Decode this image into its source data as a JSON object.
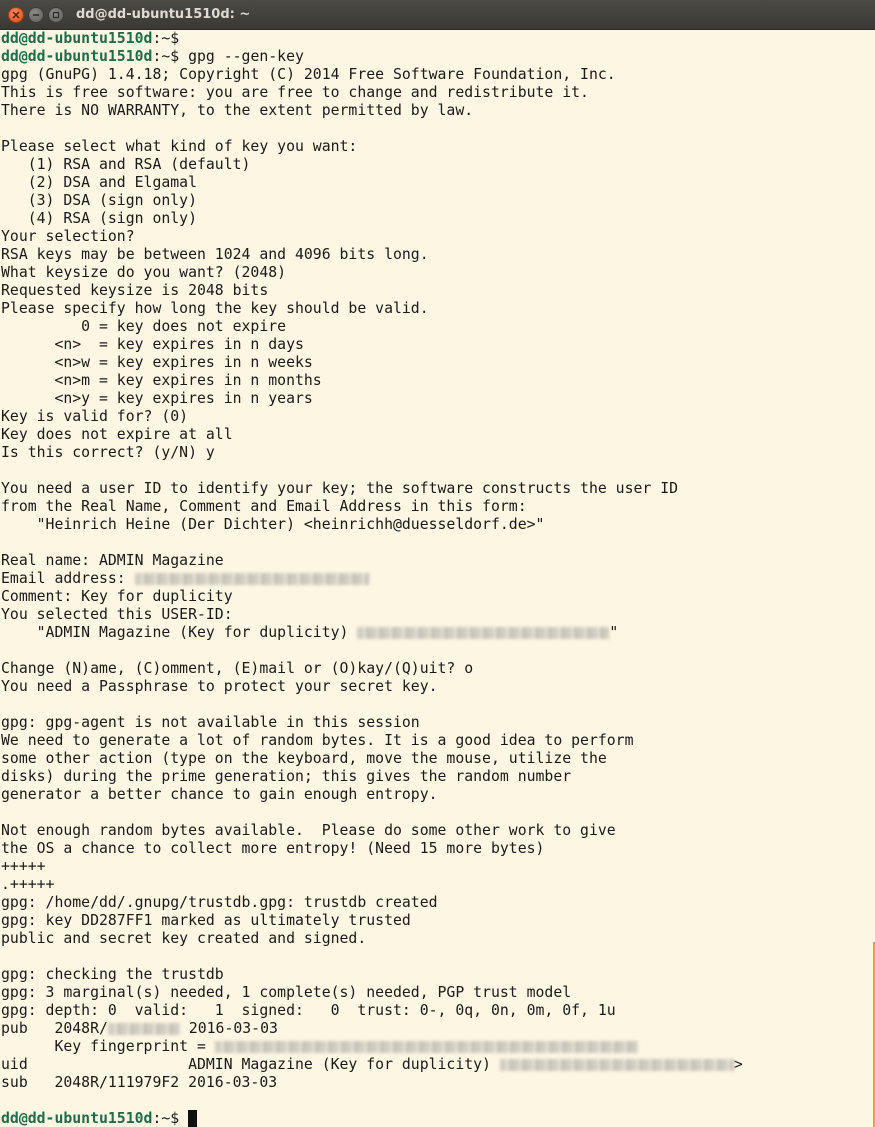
{
  "window": {
    "title": "dd@dd-ubuntu1510d: ~"
  },
  "terminal": {
    "prompt": "dd@dd-ubuntu1510d",
    "lines": [
      {
        "prompt": "dd@dd-ubuntu1510d",
        "sep": ":~$",
        "cmd": ""
      },
      {
        "prompt": "dd@dd-ubuntu1510d",
        "sep": ":~$",
        "cmd": " gpg --gen-key"
      },
      {
        "text": "gpg (GnuPG) 1.4.18; Copyright (C) 2014 Free Software Foundation, Inc."
      },
      {
        "text": "This is free software: you are free to change and redistribute it."
      },
      {
        "text": "There is NO WARRANTY, to the extent permitted by law."
      },
      {
        "text": ""
      },
      {
        "text": "Please select what kind of key you want:"
      },
      {
        "text": "   (1) RSA and RSA (default)"
      },
      {
        "text": "   (2) DSA and Elgamal"
      },
      {
        "text": "   (3) DSA (sign only)"
      },
      {
        "text": "   (4) RSA (sign only)"
      },
      {
        "text": "Your selection?"
      },
      {
        "text": "RSA keys may be between 1024 and 4096 bits long."
      },
      {
        "text": "What keysize do you want? (2048)"
      },
      {
        "text": "Requested keysize is 2048 bits"
      },
      {
        "text": "Please specify how long the key should be valid."
      },
      {
        "text": "         0 = key does not expire"
      },
      {
        "text": "      <n>  = key expires in n days"
      },
      {
        "text": "      <n>w = key expires in n weeks"
      },
      {
        "text": "      <n>m = key expires in n months"
      },
      {
        "text": "      <n>y = key expires in n years"
      },
      {
        "text": "Key is valid for? (0)"
      },
      {
        "text": "Key does not expire at all"
      },
      {
        "text": "Is this correct? (y/N) y"
      },
      {
        "text": ""
      },
      {
        "text": "You need a user ID to identify your key; the software constructs the user ID"
      },
      {
        "text": "from the Real Name, Comment and Email Address in this form:"
      },
      {
        "text": "    \"Heinrich Heine (Der Dichter) <heinrichh@duesseldorf.de>\""
      },
      {
        "text": ""
      },
      {
        "text": "Real name: ADMIN Magazine"
      },
      {
        "text": "Email address: ",
        "redacted": true,
        "redact_chars": 26
      },
      {
        "text": "Comment: Key for duplicity"
      },
      {
        "text": "You selected this USER-ID:"
      },
      {
        "text": "    \"ADMIN Magazine (Key for duplicity) ",
        "redacted": true,
        "redact_chars": 28,
        "after": "\""
      },
      {
        "text": ""
      },
      {
        "text": "Change (N)ame, (C)omment, (E)mail or (O)kay/(Q)uit? o"
      },
      {
        "text": "You need a Passphrase to protect your secret key."
      },
      {
        "text": ""
      },
      {
        "text": "gpg: gpg-agent is not available in this session"
      },
      {
        "text": "We need to generate a lot of random bytes. It is a good idea to perform"
      },
      {
        "text": "some other action (type on the keyboard, move the mouse, utilize the"
      },
      {
        "text": "disks) during the prime generation; this gives the random number"
      },
      {
        "text": "generator a better chance to gain enough entropy."
      },
      {
        "text": ""
      },
      {
        "text": "Not enough random bytes available.  Please do some other work to give"
      },
      {
        "text": "the OS a chance to collect more entropy! (Need 15 more bytes)"
      },
      {
        "text": "+++++"
      },
      {
        "text": ".+++++"
      },
      {
        "text": "gpg: /home/dd/.gnupg/trustdb.gpg: trustdb created"
      },
      {
        "text": "gpg: key DD287FF1 marked as ultimately trusted"
      },
      {
        "text": "public and secret key created and signed."
      },
      {
        "text": ""
      },
      {
        "text": "gpg: checking the trustdb"
      },
      {
        "text": "gpg: 3 marginal(s) needed, 1 complete(s) needed, PGP trust model"
      },
      {
        "text": "gpg: depth: 0  valid:   1  signed:   0  trust: 0-, 0q, 0n, 0m, 0f, 1u"
      },
      {
        "text": "pub   2048R/",
        "redacted": true,
        "redact_chars": 8,
        "after": " 2016-03-03"
      },
      {
        "text": "      Key fingerprint = ",
        "redacted": true,
        "redact_chars": 47
      },
      {
        "text": "uid                  ADMIN Magazine (Key for duplicity) ",
        "redacted": true,
        "redact_chars": 26,
        "after": ">"
      },
      {
        "text": "sub   2048R/111979F2 2016-03-03"
      },
      {
        "text": ""
      },
      {
        "prompt": "dd@dd-ubuntu1510d",
        "sep": ":~$",
        "cmd": " ",
        "cursor": true
      }
    ]
  },
  "colors": {
    "background": "#fdf6e3",
    "prompt": "#1f6b4a",
    "text": "#1a1a1a",
    "titlebar": "#3a3934",
    "close": "#df4a16"
  },
  "icons": {
    "close": "close-icon",
    "minimize": "minimize-icon",
    "maximize": "maximize-icon"
  }
}
